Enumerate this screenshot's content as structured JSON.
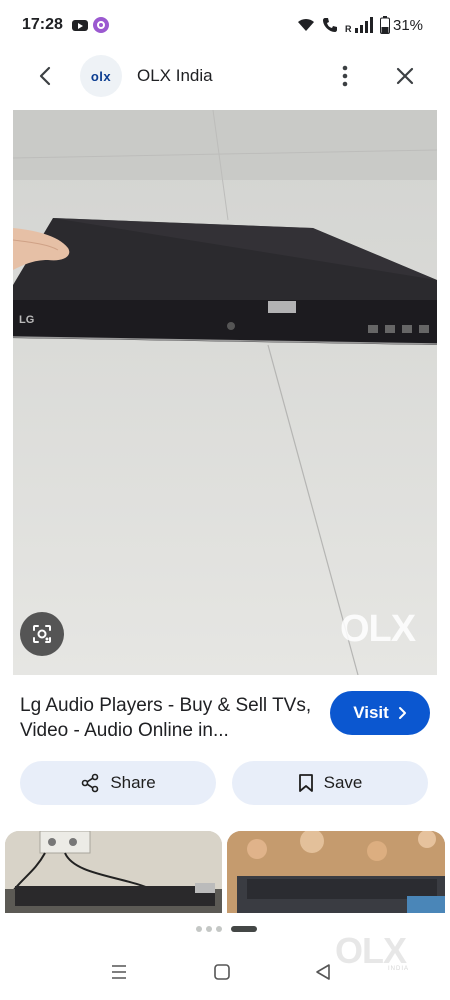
{
  "status_bar": {
    "time": "17:28",
    "battery_percent": "31%",
    "icons": [
      "youtube-icon",
      "app-icon",
      "wifi-icon",
      "call-icon",
      "roaming-r",
      "signal-icon",
      "battery-icon"
    ],
    "roaming_label": "R"
  },
  "header": {
    "logo_text": "olx",
    "site_title": "OLX India"
  },
  "image": {
    "brand_label": "LG",
    "watermark": "OLX"
  },
  "result": {
    "title": "Lg Audio Players - Buy & Sell TVs, Video - Audio Online in...",
    "visit_label": "Visit"
  },
  "actions": {
    "share_label": "Share",
    "save_label": "Save"
  },
  "carousel": {
    "active_index": 3,
    "count": 4
  },
  "nav_watermark": {
    "text": "OLX",
    "sub": "INDIA"
  },
  "colors": {
    "accent": "#0b57d0",
    "pill_bg": "#e8eef9",
    "olx_blue": "#0b3d91"
  }
}
